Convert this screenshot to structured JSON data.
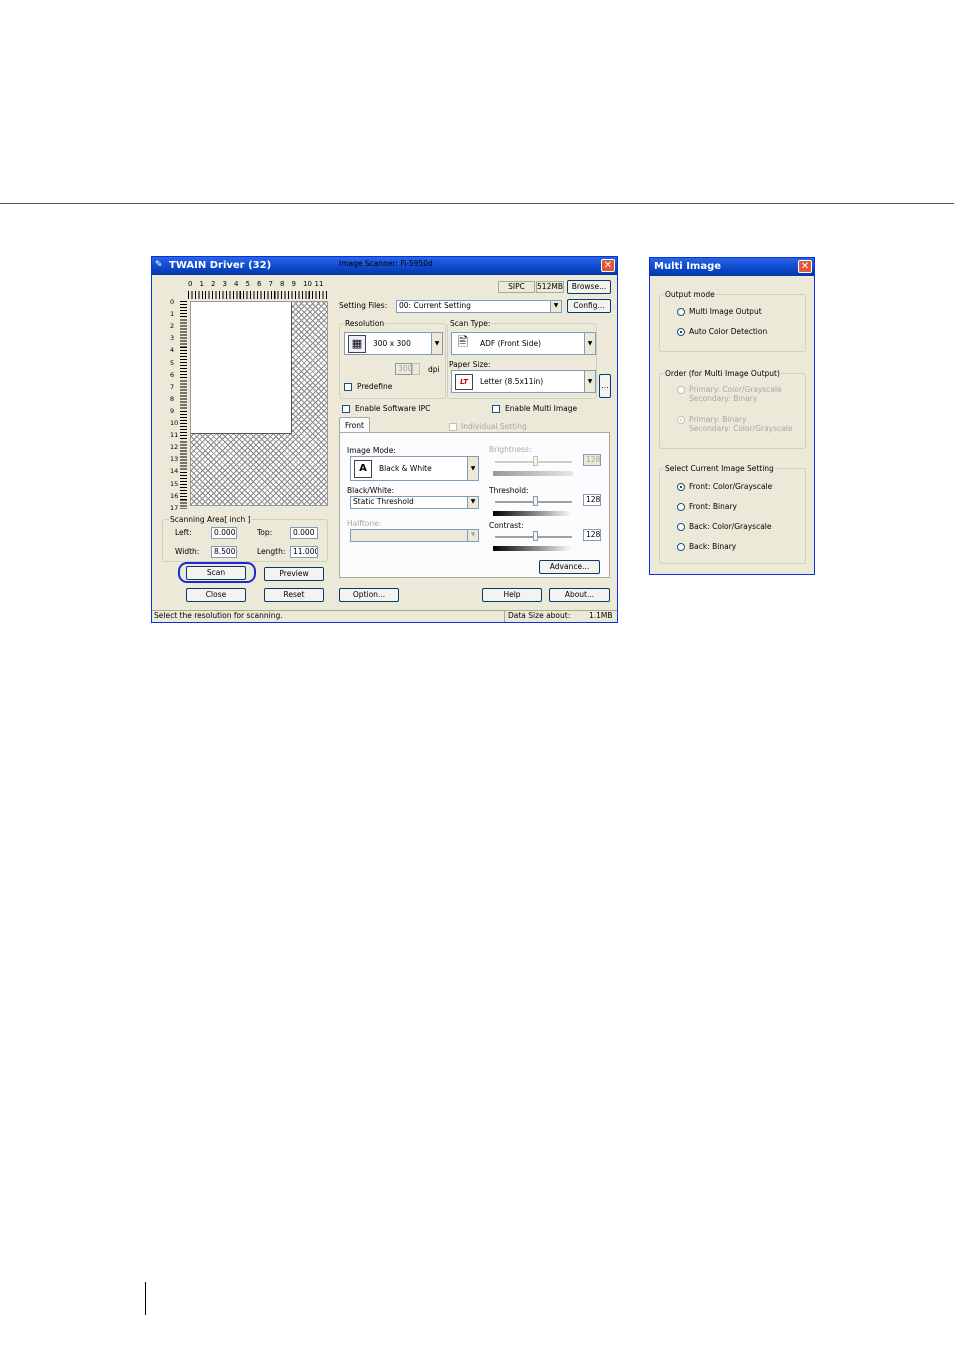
{
  "twain": {
    "title": "TWAIN Driver (32)",
    "ruler_numbers_h": [
      "0",
      "1",
      "2",
      "3",
      "4",
      "5",
      "6",
      "7",
      "8",
      "9",
      "10",
      "11"
    ],
    "ruler_numbers_v": [
      "0",
      "1",
      "2",
      "3",
      "4",
      "5",
      "6",
      "7",
      "8",
      "9",
      "10",
      "11",
      "12",
      "13",
      "14",
      "15",
      "16",
      "17"
    ],
    "scanning_area": {
      "label": "Scanning Area[ inch ]",
      "left_label": "Left:",
      "left_value": "0.000",
      "top_label": "Top:",
      "top_value": "0.000",
      "width_label": "Width:",
      "width_value": "8.500",
      "length_label": "Length:",
      "length_value": "11.000"
    },
    "buttons": {
      "scan": "Scan",
      "preview": "Preview",
      "close": "Close",
      "reset": "Reset",
      "browse": "Browse...",
      "config": "Config...",
      "paper_more": "...",
      "advance": "Advance...",
      "option": "Option...",
      "help": "Help",
      "about": "About..."
    },
    "image_scanner_label": "Image Scanner: Fi-5950d",
    "sipc": "SIPC",
    "memory": "512MB",
    "setting_files_label": "Setting Files:",
    "setting_files_value": "00: Current Setting",
    "resolution": {
      "label": "Resolution",
      "value": "300 x 300",
      "custom_value": "300",
      "unit": "dpi",
      "predefine_label": "Predefine"
    },
    "scan_type": {
      "label": "Scan Type:",
      "value": "ADF (Front Side)"
    },
    "paper_size": {
      "label": "Paper Size:",
      "value": "Letter (8.5x11in)"
    },
    "enable_software_ipc": "Enable Software IPC",
    "enable_multi_image": "Enable Multi Image",
    "tab_front": "Front",
    "individual_setting": "Individual Setting",
    "image_mode": {
      "label": "Image Mode:",
      "value": "Black & White"
    },
    "black_white": {
      "label": "Black/White:",
      "value": "Static Threshold"
    },
    "halftone_label": "Halftone:",
    "brightness": {
      "label": "Brightness:",
      "value": "128"
    },
    "threshold": {
      "label": "Threshold:",
      "value": "128"
    },
    "contrast": {
      "label": "Contrast:",
      "value": "128"
    },
    "status": {
      "message": "Select the resolution for scanning.",
      "data_size_label": "Data Size about:",
      "data_size_value": "1.1MB"
    }
  },
  "multi_image": {
    "title": "Multi Image",
    "output_mode": {
      "label": "Output mode",
      "options": [
        "Multi Image Output",
        "Auto Color Detection"
      ],
      "selected": "Auto Color Detection"
    },
    "order": {
      "label": "Order (for Multi Image Output)",
      "option1_line1": "Primary: Color/Grayscale",
      "option1_line2": "Secondary: Binary",
      "option2_line1": "Primary: Binary",
      "option2_line2": "Secondary: Color/Grayscale",
      "selected": "Primary: Binary"
    },
    "select_current": {
      "label": "Select Current Image Setting",
      "options": [
        "Front: Color/Grayscale",
        "Front: Binary",
        "Back: Color/Grayscale",
        "Back: Binary"
      ],
      "selected": "Front: Color/Grayscale"
    }
  }
}
